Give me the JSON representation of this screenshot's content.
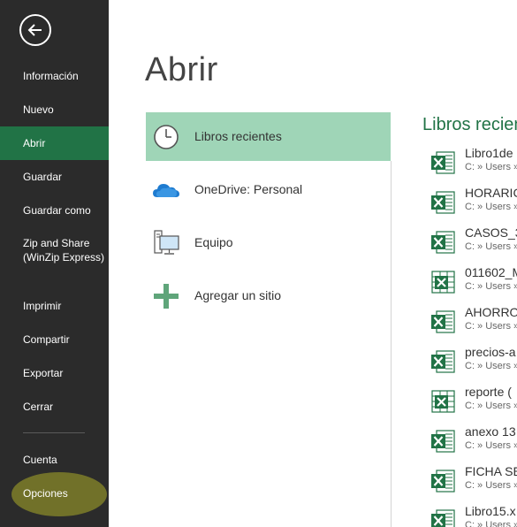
{
  "sidebar": {
    "items": [
      {
        "label": "Información"
      },
      {
        "label": "Nuevo"
      },
      {
        "label": "Abrir",
        "active": true
      },
      {
        "label": "Guardar"
      },
      {
        "label": "Guardar como"
      },
      {
        "label": "Zip and Share (WinZip Express)"
      },
      {
        "label": "Imprimir"
      },
      {
        "label": "Compartir"
      },
      {
        "label": "Exportar"
      },
      {
        "label": "Cerrar"
      },
      {
        "label": "Cuenta"
      },
      {
        "label": "Opciones"
      }
    ],
    "colors": {
      "background": "#2b2b2b",
      "active": "#217346",
      "text": "#ffffff"
    }
  },
  "main": {
    "title": "Abrir",
    "places": [
      {
        "label": "Libros recientes",
        "icon": "clock-icon",
        "active": true
      },
      {
        "label": "OneDrive: Personal",
        "icon": "onedrive-cloud-icon"
      },
      {
        "label": "Equipo",
        "icon": "computer-icon"
      },
      {
        "label": "Agregar un sitio",
        "icon": "plus-icon"
      }
    ],
    "recent_header": "Libros recien",
    "recent_files": [
      {
        "name": "Libro1de",
        "path": "C: » Users »",
        "icon": "excel-icon"
      },
      {
        "name": "HORARIC",
        "path": "C: » Users »",
        "icon": "excel-icon"
      },
      {
        "name": "CASOS_3",
        "path": "C: » Users »",
        "icon": "excel-icon"
      },
      {
        "name": "011602_M",
        "path": "C: » Users »",
        "icon": "excel-csv-icon"
      },
      {
        "name": "AHORRO",
        "path": "C: » Users »",
        "icon": "excel-icon"
      },
      {
        "name": "precios-a",
        "path": "C: » Users »",
        "icon": "excel-icon"
      },
      {
        "name": "reporte (",
        "path": "C: » Users »",
        "icon": "excel-csv-icon"
      },
      {
        "name": "anexo 13",
        "path": "C: » Users »",
        "icon": "excel-icon"
      },
      {
        "name": "FICHA SE",
        "path": "C: » Users »",
        "icon": "excel-icon"
      },
      {
        "name": "Libro15.x",
        "path": "C: » Users »",
        "icon": "excel-icon"
      }
    ],
    "colors": {
      "accent": "#217346",
      "active_place": "#9fd5b7"
    }
  }
}
